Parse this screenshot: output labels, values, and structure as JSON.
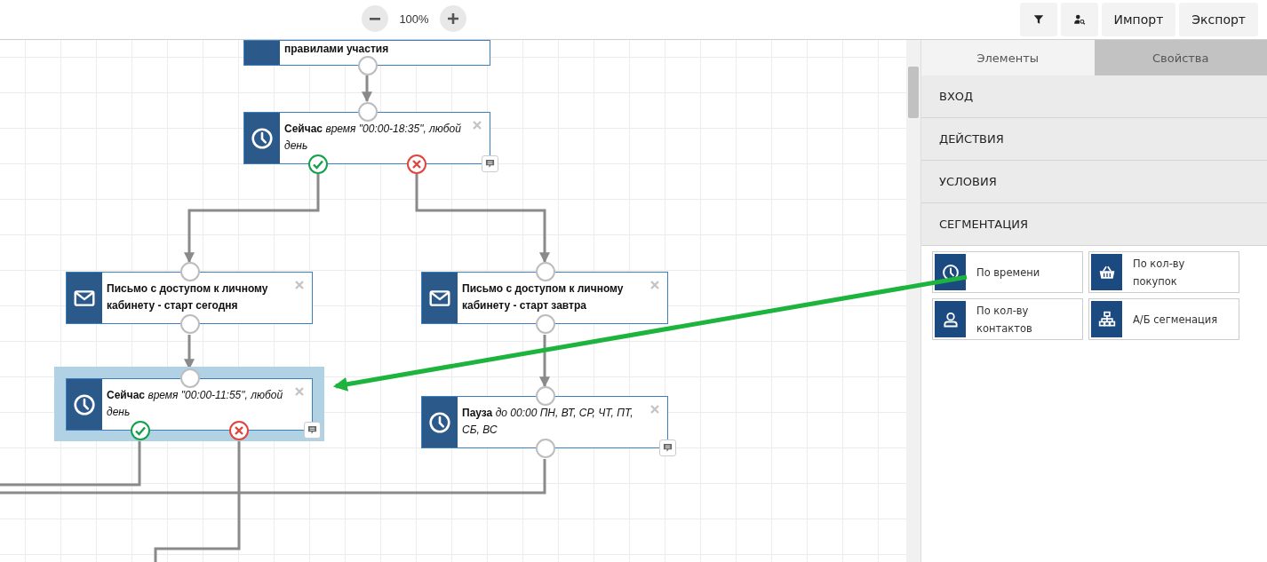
{
  "toolbar": {
    "zoom": {
      "value": "100%"
    },
    "actions": [
      {
        "kind": "filter"
      },
      {
        "kind": "user-search"
      },
      {
        "kind": "text",
        "label": "Импорт"
      },
      {
        "kind": "text",
        "label": "Экспорт"
      }
    ]
  },
  "canvas": {
    "nodes": [
      {
        "kind": "partial",
        "text": "правилами участия",
        "selected": false
      },
      {
        "kind": "condition",
        "text": "Сейчас *время \"00:00-18:35\", любой день*",
        "selected": false
      },
      {
        "kind": "email",
        "text": "Письмо с доступом к личному кабинету - старт сегодня",
        "selected": false
      },
      {
        "kind": "email",
        "text": "Письмо с доступом к личному кабинету - старт завтра",
        "selected": false
      },
      {
        "kind": "condition",
        "text": "Сейчас *время \"00:00-11:55\", любой день*",
        "selected": true
      },
      {
        "kind": "pause",
        "text": "Пауза *до 00:00 ПН, ВТ, СР, ЧТ, ПТ, СБ, ВС*",
        "selected": false
      }
    ]
  },
  "sidebar": {
    "tabs": [
      {
        "label": "Элементы",
        "selected": true
      },
      {
        "label": "Свойства",
        "selected": false
      }
    ],
    "sections": [
      {
        "label": "ВХОД"
      },
      {
        "label": "ДЕЙСТВИЯ"
      },
      {
        "label": "УСЛОВИЯ"
      },
      {
        "label": "СЕГМЕНТАЦИЯ",
        "items": [
          {
            "kind": "time",
            "label": "По времени"
          },
          {
            "kind": "purchases",
            "label": "По кол-ву покупок"
          },
          {
            "kind": "contacts",
            "label": "По кол-ву контактов"
          },
          {
            "kind": "ab",
            "label": "А/Б сегменация"
          }
        ]
      }
    ]
  }
}
